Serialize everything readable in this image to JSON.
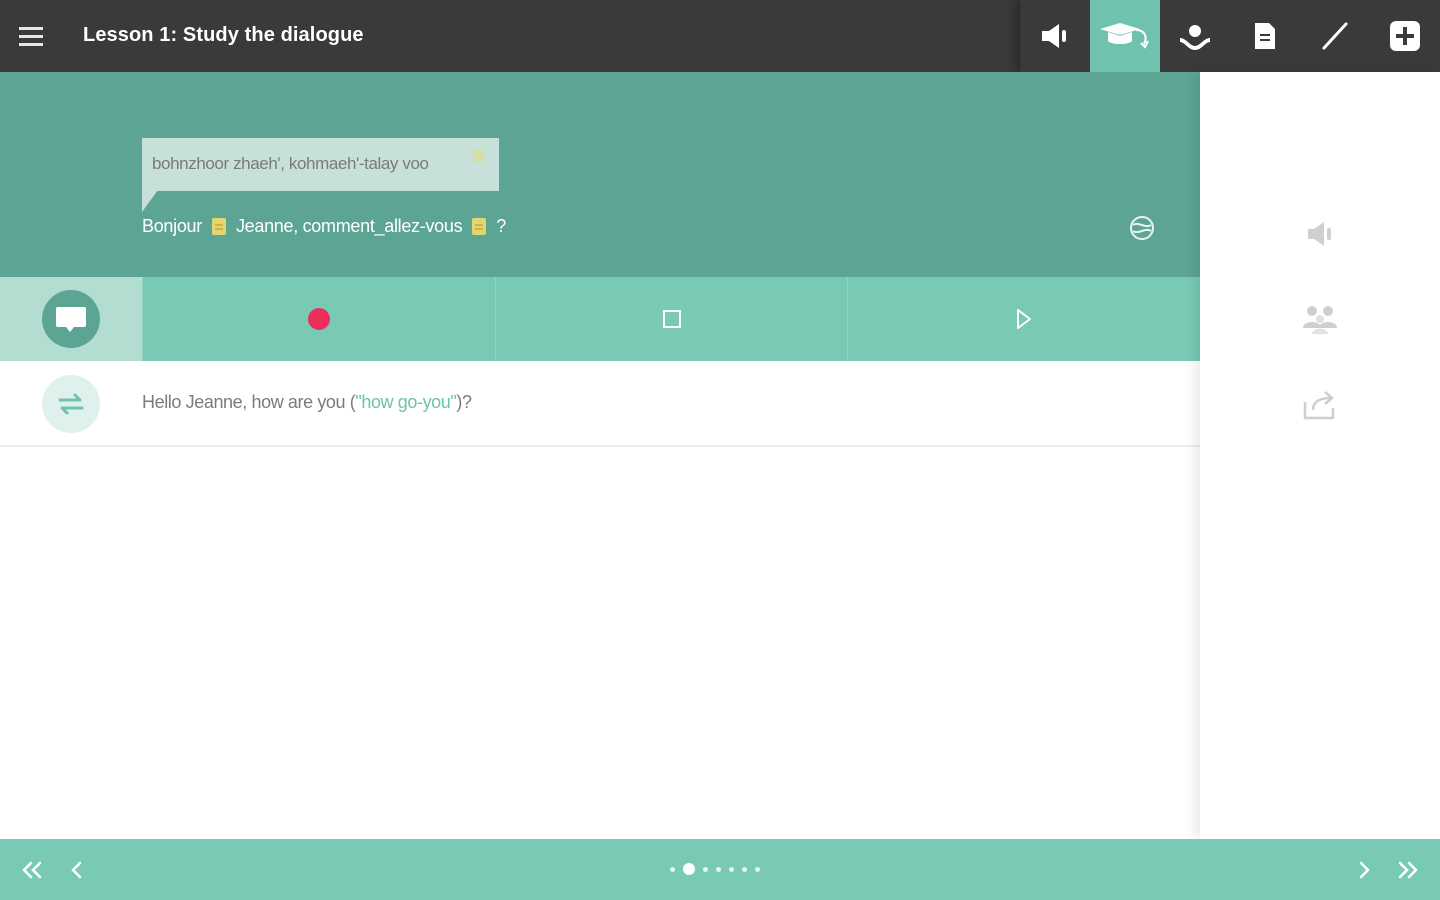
{
  "header": {
    "title": "Lesson 1: Study the dialogue",
    "tools": [
      {
        "icon": "speaker-icon"
      },
      {
        "icon": "graduation-cap-icon",
        "active": true
      },
      {
        "icon": "hand-coin-icon"
      },
      {
        "icon": "document-icon"
      },
      {
        "icon": "pen-icon"
      },
      {
        "icon": "plus-box-icon"
      }
    ]
  },
  "dialogue": {
    "phonetic": "bohnzhoor zhaeh', kohmaeh'-talay voo",
    "words": [
      "Bonjour",
      "Jeanne, comment_allez-vous",
      "?"
    ]
  },
  "translation": {
    "prefix": "Hello Jeanne, how are you (",
    "literal": "\"how go-you\"",
    "suffix": ")?"
  },
  "pagination": {
    "total": 7,
    "current": 2
  },
  "colors": {
    "topbar": "#3a3a3a",
    "accent": "#6ec2ae",
    "hero": "#5ca595",
    "controls": "#78cab5",
    "record": "#ec2e5c"
  }
}
